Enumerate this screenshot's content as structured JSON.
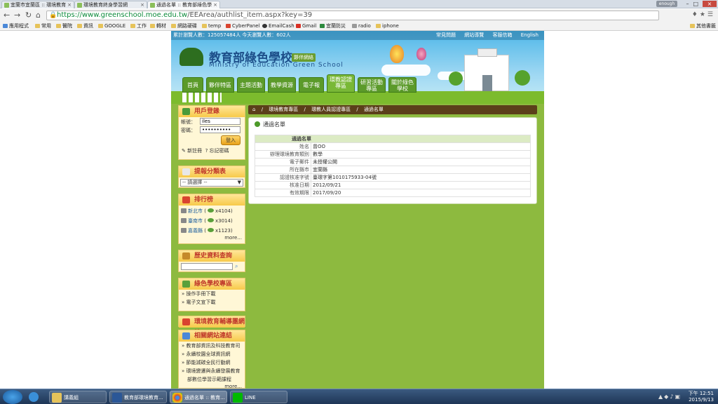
{
  "browser": {
    "tabs": [
      {
        "title": "宜蘭市宜蘭區 :: 環境教育"
      },
      {
        "title": "環境教育終身學習網"
      },
      {
        "title": "通過名單 :: 教育部綠色學"
      }
    ],
    "user_badge": "enough",
    "url_host": "https://www.greenschool.moe.edu.tw",
    "url_path": "/EEArea/authlist_item.aspx?key=39",
    "bookmarks": [
      "應用程式",
      "常用",
      "醫院",
      "資訊",
      "GOOGLE",
      "工作",
      "轉材",
      "網路硬碟",
      "temp",
      "CyberPanel",
      "EmailCash",
      "Gmail",
      "宜蘭防災",
      "radio",
      "iphone"
    ],
    "bookmarks_other": "其他書籤"
  },
  "site": {
    "counter": "累計瀏覽人數：125057484人  今天瀏覽人數：602人",
    "top_links": [
      "常見問題",
      "網站導覽",
      "客服信箱",
      "English"
    ],
    "logo_title": "教育部綠色學校",
    "logo_tag": "夥伴網絡",
    "logo_en": "Ministry of Education Green School",
    "menu": [
      {
        "label": "首頁"
      },
      {
        "label": "夥伴特區"
      },
      {
        "label": "主題活動"
      },
      {
        "label": "教學資源"
      },
      {
        "label": "電子報"
      },
      {
        "label": "環教認證專區"
      },
      {
        "label": "研習活動專區"
      },
      {
        "label": "關於綠色學校"
      }
    ]
  },
  "login": {
    "title": "用戶登錄",
    "account_label": "帳號：",
    "account_value": "iles",
    "password_label": "密碼：",
    "password_value": "••••••••••",
    "login_button": "登入",
    "register": "新註冊",
    "forgot": "忘記密碼"
  },
  "report": {
    "title": "提報分類表",
    "select": "-- 請選擇 --"
  },
  "ranking": {
    "title": "排行榜",
    "items": [
      {
        "city": "新北市",
        "count": "x4104"
      },
      {
        "city": "臺南市",
        "count": "x3014"
      },
      {
        "city": "嘉義縣",
        "count": "x1123"
      }
    ],
    "more": "more..."
  },
  "history": {
    "title": "歷史資料查詢"
  },
  "zone": {
    "title": "綠色學校專區",
    "links": [
      "» 操作手冊下載",
      "» 電子文宣下載"
    ]
  },
  "guide_banner": "環境教育輔導團網站",
  "related": {
    "title": "相關網站連結",
    "links": [
      "» 教育部資訊及科技教育司",
      "» 永續校園全球資訊網",
      "» 節能減碳全民行動網",
      "» 環境變遷與永續發展教育"
    ],
    "extra": "部數位學習示範課程",
    "more": "more..."
  },
  "breadcrumb": [
    "環境教育專區",
    "環教人員認證專區",
    "通過名單"
  ],
  "panel": {
    "title": "通過名單",
    "header": "通過名單",
    "rows": [
      {
        "k": "姓名",
        "v": "曾OO"
      },
      {
        "k": "辦理環境教育類別",
        "v": "數學"
      },
      {
        "k": "電子郵件",
        "v": "未授權公開"
      },
      {
        "k": "所在縣市",
        "v": "宜蘭縣"
      },
      {
        "k": "認證核准字號",
        "v": "臺環字第1010175933-04號"
      },
      {
        "k": "核准日期",
        "v": "2012/09/21"
      },
      {
        "k": "有效期限",
        "v": "2017/09/20"
      }
    ]
  },
  "taskbar": {
    "items": [
      "講義組",
      "教育部環境教育...",
      "通過名單 :: 教育...",
      "LINE"
    ],
    "time": "下午 12:51",
    "date": "2015/9/13"
  }
}
